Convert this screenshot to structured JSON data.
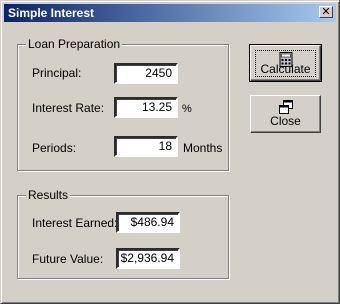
{
  "window": {
    "title": "Simple Interest",
    "close_glyph": "✕"
  },
  "loan": {
    "legend": "Loan Preparation",
    "principal_label": "Principal:",
    "principal_value": "2450",
    "rate_label": "Interest Rate:",
    "rate_value": "13.25",
    "rate_unit": "%",
    "periods_label": "Periods:",
    "periods_value": "18",
    "periods_unit": "Months"
  },
  "results": {
    "legend": "Results",
    "earned_label": "Interest Earned:",
    "earned_value": "$486.94",
    "future_label": "Future Value:",
    "future_value": "$2,936.94"
  },
  "buttons": {
    "calculate": {
      "label": "Calculate",
      "icon": "calculator-icon"
    },
    "close": {
      "label": "Close",
      "icon": "close-window-icon"
    }
  }
}
